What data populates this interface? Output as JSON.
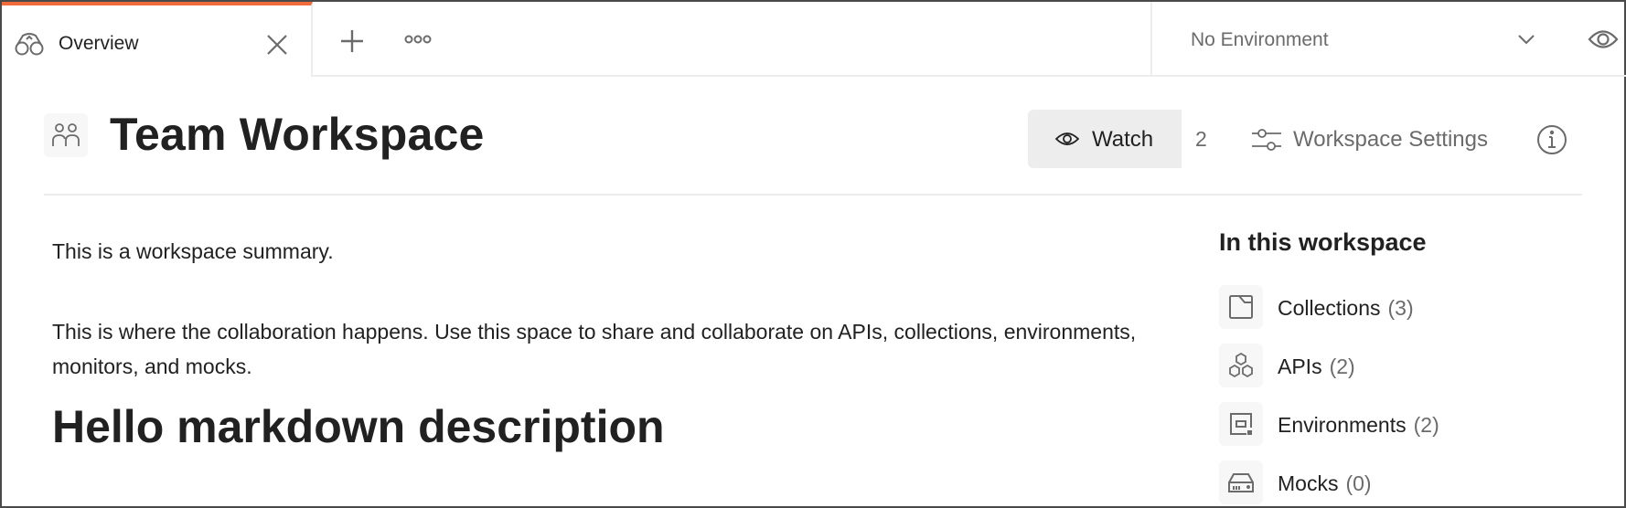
{
  "tabs": {
    "active": {
      "label": "Overview",
      "icon": "binoculars-icon"
    },
    "close_icon": "close-icon",
    "add_icon": "plus-icon",
    "more_icon": "more-horizontal-icon"
  },
  "environment": {
    "selected": "No Environment",
    "chevron_icon": "chevron-down-icon",
    "quicklook_icon": "eye-icon"
  },
  "colors": {
    "active_tab_accent": "#f26b3a",
    "text_primary": "#212121",
    "text_secondary": "#6b6b6b",
    "button_bg": "#ededed",
    "icon_box_bg": "#f7f7f7"
  },
  "header": {
    "workspace_icon": "team-icon",
    "title": "Team Workspace",
    "watch_label": "Watch",
    "watch_count": "2",
    "settings_label": "Workspace Settings",
    "info_icon": "info-icon"
  },
  "description": {
    "paragraphs": [
      "This is a workspace summary.",
      "This is where the collaboration happens. Use this space to share and collaborate on APIs, collections, environments, monitors, and mocks."
    ],
    "heading": "Hello markdown description"
  },
  "sidebar": {
    "title": "In this workspace",
    "items": [
      {
        "label": "Collections",
        "count": "(3)",
        "icon": "collection-icon"
      },
      {
        "label": "APIs",
        "count": "(2)",
        "icon": "api-icon"
      },
      {
        "label": "Environments",
        "count": "(2)",
        "icon": "environment-icon"
      },
      {
        "label": "Mocks",
        "count": "(0)",
        "icon": "mock-server-icon"
      }
    ]
  }
}
